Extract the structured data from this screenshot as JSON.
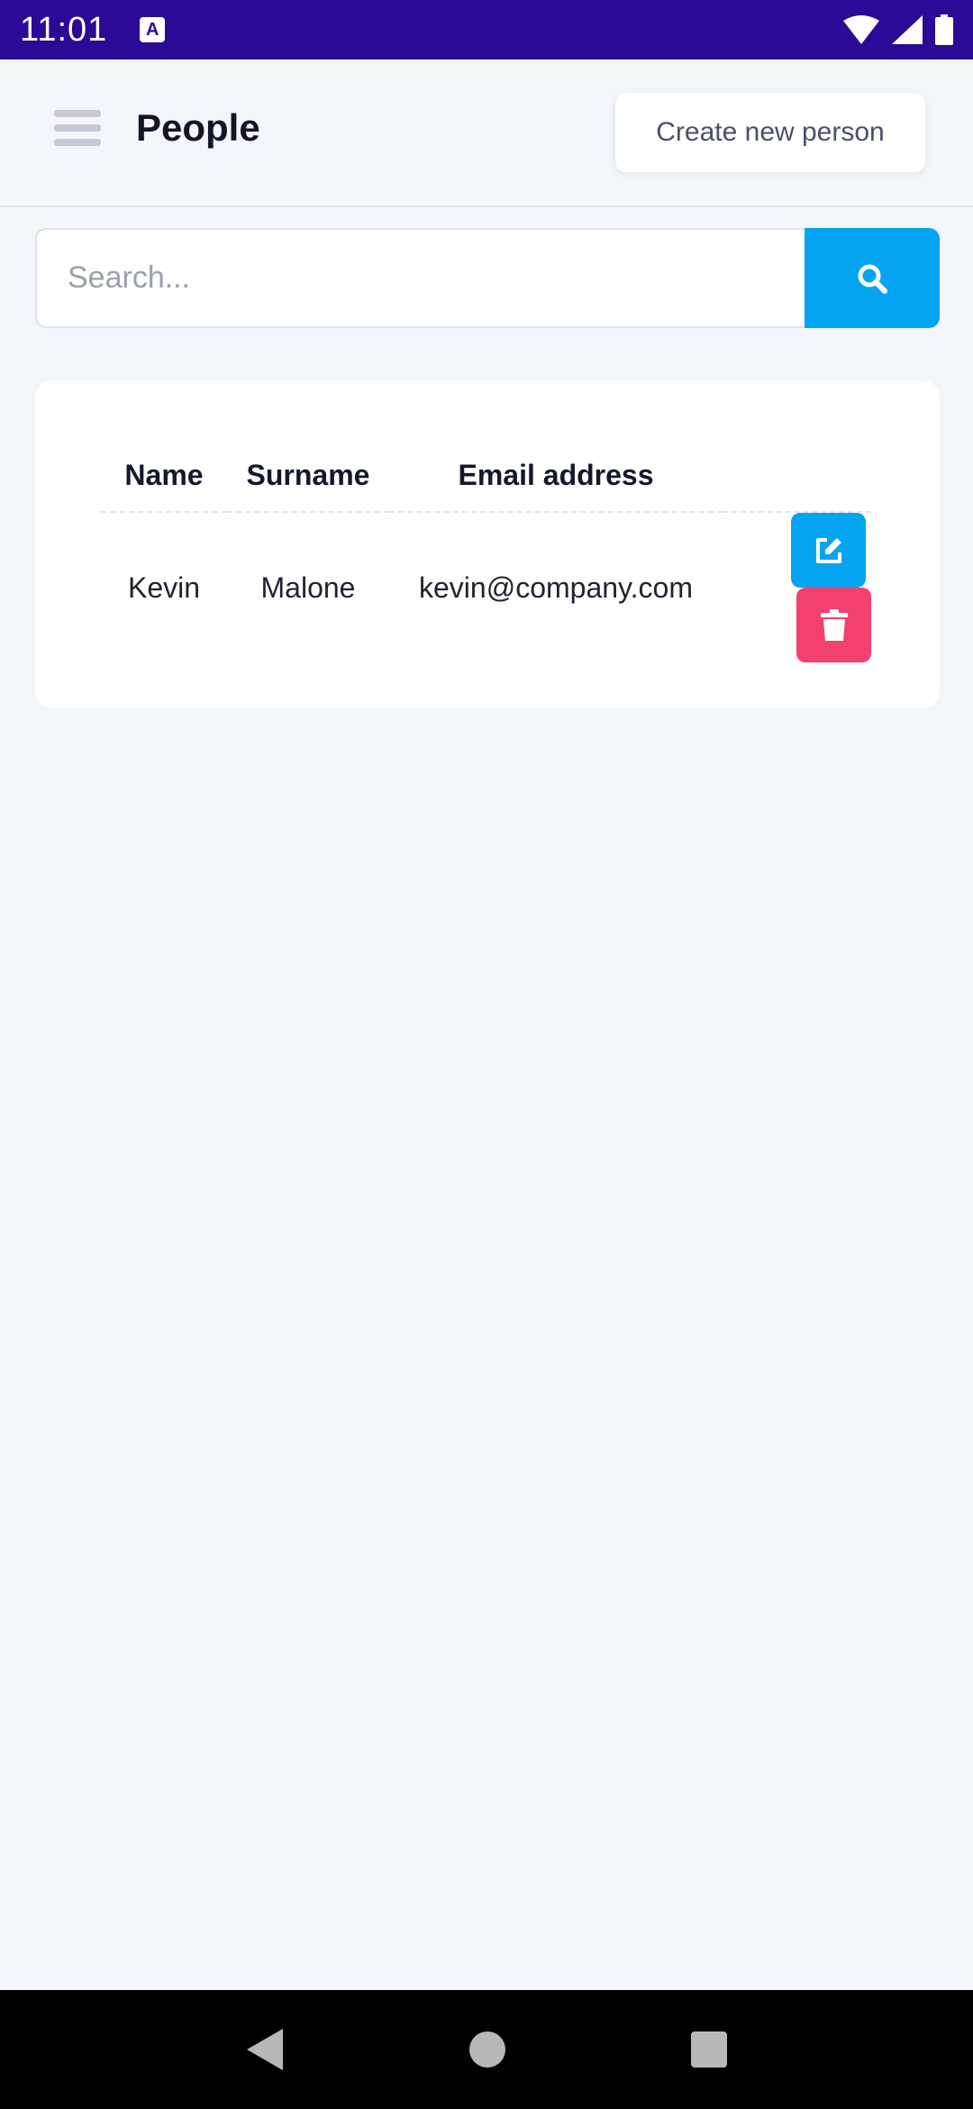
{
  "status": {
    "time": "11:01",
    "badge": "A"
  },
  "header": {
    "title": "People",
    "create_label": "Create new person"
  },
  "search": {
    "placeholder": "Search...",
    "value": ""
  },
  "table": {
    "columns": [
      "Name",
      "Surname",
      "Email address"
    ],
    "rows": [
      {
        "name": "Kevin",
        "surname": "Malone",
        "email": "kevin@company.com"
      }
    ]
  },
  "colors": {
    "status_bar": "#2a0a96",
    "accent": "#05a4f0",
    "danger": "#f2416e",
    "background": "#f3f6fa"
  },
  "icons": {
    "menu": "hamburger-icon",
    "search": "search-icon",
    "edit": "edit-icon",
    "delete": "trash-icon"
  }
}
